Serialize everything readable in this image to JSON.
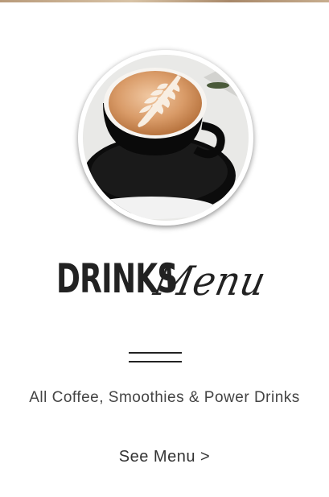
{
  "hero_image": {
    "alt": "Latte art in black cup"
  },
  "heading": {
    "bold": "DRINKS",
    "script": "Menu"
  },
  "subtitle": "All Coffee, Smoothies & Power Drinks",
  "cta": {
    "label": "See Menu >"
  },
  "colors": {
    "text": "#2b2b2b",
    "background": "#ffffff",
    "coffee": "#d9a276"
  }
}
